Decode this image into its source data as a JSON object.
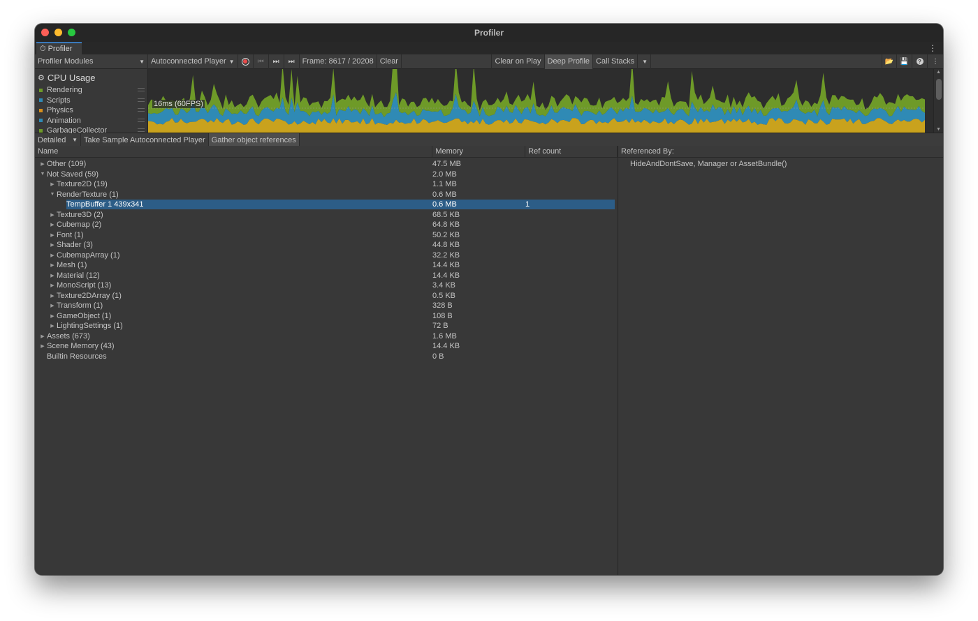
{
  "window": {
    "title": "Profiler"
  },
  "tab": {
    "label": "Profiler",
    "icon": "profiler-icon"
  },
  "toolbar": {
    "modules_label": "Profiler Modules",
    "target_label": "Autoconnected Player",
    "frame_text": "Frame: 8617 / 20208",
    "clear_label": "Clear",
    "clear_on_play_label": "Clear on Play",
    "deep_profile_label": "Deep Profile",
    "call_stacks_label": "Call Stacks"
  },
  "cpu_module": {
    "title": "CPU Usage",
    "fps_label": "16ms (60FPS)",
    "items": [
      {
        "label": "Rendering",
        "color": "#6e9a28"
      },
      {
        "label": "Scripts",
        "color": "#2f8ab5"
      },
      {
        "label": "Physics",
        "color": "#d68f1b"
      },
      {
        "label": "Animation",
        "color": "#2f8ab5"
      },
      {
        "label": "GarbageCollector",
        "color": "#6e9a28"
      }
    ]
  },
  "subtoolbar": {
    "view_label": "Detailed",
    "take_sample_label": "Take Sample Autoconnected Player",
    "gather_label": "Gather object references"
  },
  "table": {
    "headers": {
      "name": "Name",
      "memory": "Memory",
      "ref_count": "Ref count"
    },
    "rows": [
      {
        "name": "Other (109)",
        "memory": "47.5 MB",
        "ref": "",
        "indent": 0,
        "arrow": "right",
        "selected": false
      },
      {
        "name": "Not Saved (59)",
        "memory": "2.0 MB",
        "ref": "",
        "indent": 0,
        "arrow": "down",
        "selected": false
      },
      {
        "name": "Texture2D (19)",
        "memory": "1.1 MB",
        "ref": "",
        "indent": 1,
        "arrow": "right",
        "selected": false
      },
      {
        "name": "RenderTexture (1)",
        "memory": "0.6 MB",
        "ref": "",
        "indent": 1,
        "arrow": "down",
        "selected": false
      },
      {
        "name": "TempBuffer 1 439x341",
        "memory": "0.6 MB",
        "ref": "1",
        "indent": 2,
        "arrow": "none",
        "selected": true
      },
      {
        "name": "Texture3D (2)",
        "memory": "68.5 KB",
        "ref": "",
        "indent": 1,
        "arrow": "right",
        "selected": false
      },
      {
        "name": "Cubemap (2)",
        "memory": "64.8 KB",
        "ref": "",
        "indent": 1,
        "arrow": "right",
        "selected": false
      },
      {
        "name": "Font (1)",
        "memory": "50.2 KB",
        "ref": "",
        "indent": 1,
        "arrow": "right",
        "selected": false
      },
      {
        "name": "Shader (3)",
        "memory": "44.8 KB",
        "ref": "",
        "indent": 1,
        "arrow": "right",
        "selected": false
      },
      {
        "name": "CubemapArray (1)",
        "memory": "32.2 KB",
        "ref": "",
        "indent": 1,
        "arrow": "right",
        "selected": false
      },
      {
        "name": "Mesh (1)",
        "memory": "14.4 KB",
        "ref": "",
        "indent": 1,
        "arrow": "right",
        "selected": false
      },
      {
        "name": "Material (12)",
        "memory": "14.4 KB",
        "ref": "",
        "indent": 1,
        "arrow": "right",
        "selected": false
      },
      {
        "name": "MonoScript (13)",
        "memory": "3.4 KB",
        "ref": "",
        "indent": 1,
        "arrow": "right",
        "selected": false
      },
      {
        "name": "Texture2DArray (1)",
        "memory": "0.5 KB",
        "ref": "",
        "indent": 1,
        "arrow": "right",
        "selected": false
      },
      {
        "name": "Transform (1)",
        "memory": "328 B",
        "ref": "",
        "indent": 1,
        "arrow": "right",
        "selected": false
      },
      {
        "name": "GameObject (1)",
        "memory": "108 B",
        "ref": "",
        "indent": 1,
        "arrow": "right",
        "selected": false
      },
      {
        "name": "LightingSettings (1)",
        "memory": "72 B",
        "ref": "",
        "indent": 1,
        "arrow": "right",
        "selected": false
      },
      {
        "name": "Assets (673)",
        "memory": "1.6 MB",
        "ref": "",
        "indent": 0,
        "arrow": "right",
        "selected": false
      },
      {
        "name": "Scene Memory (43)",
        "memory": "14.4 KB",
        "ref": "",
        "indent": 0,
        "arrow": "right",
        "selected": false
      },
      {
        "name": "Builtin Resources",
        "memory": "0 B",
        "ref": "",
        "indent": 0,
        "arrow": "none",
        "selected": false
      }
    ]
  },
  "referenced_by": {
    "header": "Referenced By:",
    "items": [
      "HideAndDontSave, Manager or AssetBundle()"
    ]
  },
  "colors": {
    "accent": "#2c5d87",
    "rendering": "#6e9a28",
    "scripts": "#2f8ab5",
    "other": "#c9a21d"
  }
}
